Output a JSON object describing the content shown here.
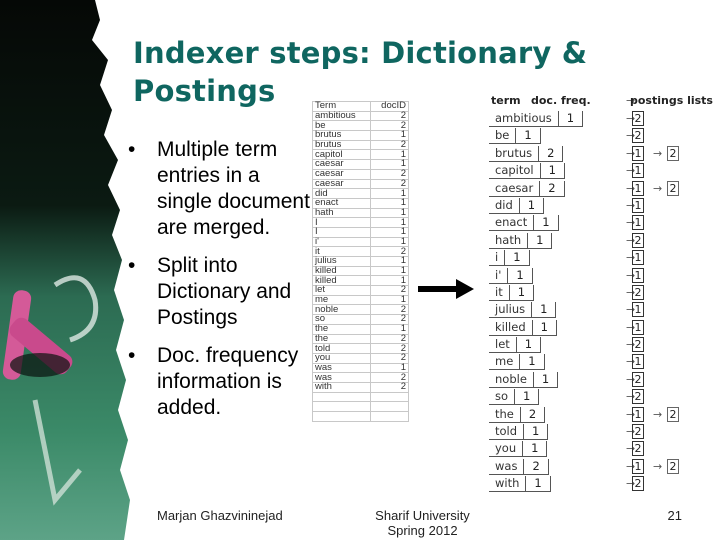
{
  "slide": {
    "title": "Indexer steps: Dictionary & Postings",
    "bullets": [
      "Multiple term entries in a single document are merged.",
      "Split into Dictionary and Postings",
      "Doc. frequency information is added."
    ],
    "bullet_glyph": "•",
    "footer": {
      "author": "Marjan Ghazvininejad",
      "institution": "Sharif University Spring 2012",
      "page_number": "21"
    },
    "colors": {
      "title": "#0f6660",
      "chalkboard": "#2f7a5c",
      "chalk_pink": "#d0508f"
    }
  },
  "term_table": {
    "headers": [
      "Term",
      "docID"
    ],
    "rows": [
      [
        "ambitious",
        "2"
      ],
      [
        "be",
        "2"
      ],
      [
        "brutus",
        "1"
      ],
      [
        "brutus",
        "2"
      ],
      [
        "capitol",
        "1"
      ],
      [
        "caesar",
        "1"
      ],
      [
        "caesar",
        "2"
      ],
      [
        "caesar",
        "2"
      ],
      [
        "did",
        "1"
      ],
      [
        "enact",
        "1"
      ],
      [
        "hath",
        "1"
      ],
      [
        "I",
        "1"
      ],
      [
        "I",
        "1"
      ],
      [
        "i'",
        "1"
      ],
      [
        "it",
        "2"
      ],
      [
        "julius",
        "1"
      ],
      [
        "killed",
        "1"
      ],
      [
        "killed",
        "1"
      ],
      [
        "let",
        "2"
      ],
      [
        "me",
        "1"
      ],
      [
        "noble",
        "2"
      ],
      [
        "so",
        "2"
      ],
      [
        "the",
        "1"
      ],
      [
        "the",
        "2"
      ],
      [
        "told",
        "2"
      ],
      [
        "you",
        "2"
      ],
      [
        "was",
        "1"
      ],
      [
        "was",
        "2"
      ],
      [
        "with",
        "2"
      ],
      [
        "",
        ""
      ],
      [
        "",
        ""
      ],
      [
        "",
        ""
      ]
    ]
  },
  "dictionary_postings": {
    "headers": {
      "term": "term",
      "freq": "doc. freq.",
      "arrow": "→",
      "postings": "postings lists"
    },
    "arrow_glyph": "→",
    "rows": [
      {
        "term": "ambitious",
        "freq": "1",
        "postings": [
          "2"
        ]
      },
      {
        "term": "be",
        "freq": "1",
        "postings": [
          "2"
        ]
      },
      {
        "term": "brutus",
        "freq": "2",
        "postings": [
          "1",
          "2"
        ]
      },
      {
        "term": "capitol",
        "freq": "1",
        "postings": [
          "1"
        ]
      },
      {
        "term": "caesar",
        "freq": "2",
        "postings": [
          "1",
          "2"
        ]
      },
      {
        "term": "did",
        "freq": "1",
        "postings": [
          "1"
        ]
      },
      {
        "term": "enact",
        "freq": "1",
        "postings": [
          "1"
        ]
      },
      {
        "term": "hath",
        "freq": "1",
        "postings": [
          "2"
        ]
      },
      {
        "term": "i",
        "freq": "1",
        "postings": [
          "1"
        ]
      },
      {
        "term": "i'",
        "freq": "1",
        "postings": [
          "1"
        ]
      },
      {
        "term": "it",
        "freq": "1",
        "postings": [
          "2"
        ]
      },
      {
        "term": "julius",
        "freq": "1",
        "postings": [
          "1"
        ]
      },
      {
        "term": "killed",
        "freq": "1",
        "postings": [
          "1"
        ]
      },
      {
        "term": "let",
        "freq": "1",
        "postings": [
          "2"
        ]
      },
      {
        "term": "me",
        "freq": "1",
        "postings": [
          "1"
        ]
      },
      {
        "term": "noble",
        "freq": "1",
        "postings": [
          "2"
        ]
      },
      {
        "term": "so",
        "freq": "1",
        "postings": [
          "2"
        ]
      },
      {
        "term": "the",
        "freq": "2",
        "postings": [
          "1",
          "2"
        ]
      },
      {
        "term": "told",
        "freq": "1",
        "postings": [
          "2"
        ]
      },
      {
        "term": "you",
        "freq": "1",
        "postings": [
          "2"
        ]
      },
      {
        "term": "was",
        "freq": "2",
        "postings": [
          "1",
          "2"
        ]
      },
      {
        "term": "with",
        "freq": "1",
        "postings": [
          "2"
        ]
      }
    ]
  }
}
